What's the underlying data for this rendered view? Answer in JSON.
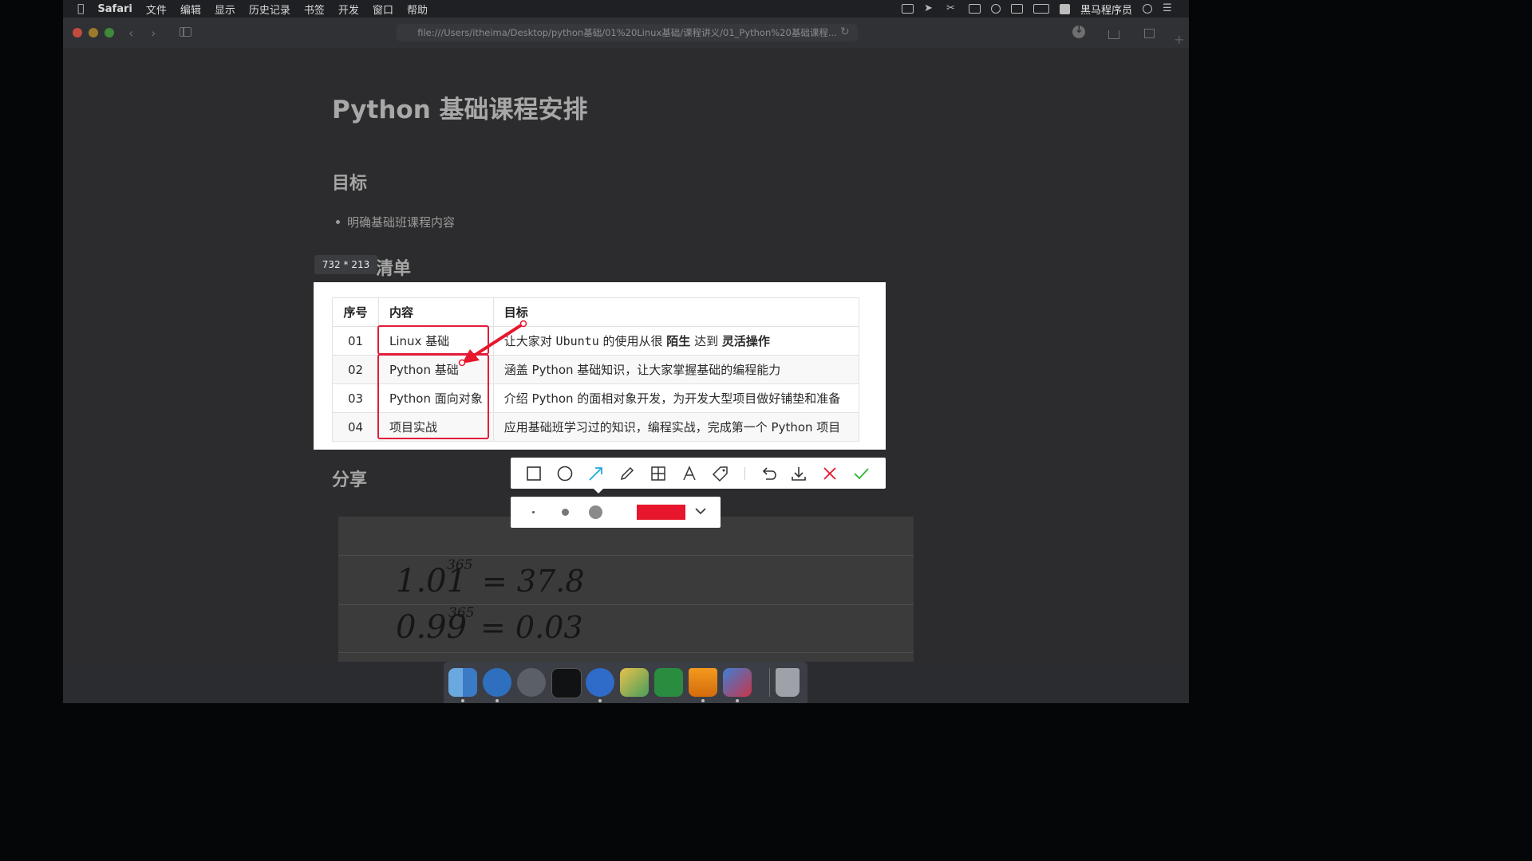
{
  "menubar": {
    "app": "Safari",
    "items": [
      "文件",
      "编辑",
      "显示",
      "历史记录",
      "书签",
      "开发",
      "窗口",
      "帮助"
    ],
    "user": "黑马程序员"
  },
  "browser": {
    "url": "file:///Users/itheima/Desktop/python基础/01%20Linux基础/课程讲义/01_Python%20基础课程..."
  },
  "page": {
    "title": "Python 基础课程安排",
    "goal_heading": "目标",
    "goal_item": "明确基础班课程内容",
    "list_heading_partial": "清单",
    "share_heading": "分享"
  },
  "capture": {
    "size_label": "732 * 213",
    "table": {
      "headers": [
        "序号",
        "内容",
        "目标"
      ],
      "rows": [
        {
          "seq": "01",
          "content": "Linux 基础",
          "goal_pre": "让大家对 ",
          "goal_mono": "Ubuntu",
          "goal_mid": " 的使用从很 ",
          "goal_b1": "陌生",
          "goal_mid2": " 达到 ",
          "goal_b2": "灵活操作"
        },
        {
          "seq": "02",
          "content": "Python 基础",
          "goal": "涵盖 Python 基础知识，让大家掌握基础的编程能力"
        },
        {
          "seq": "03",
          "content": "Python 面向对象",
          "goal": "介绍 Python 的面相对象开发，为开发大型项目做好铺垫和准备"
        },
        {
          "seq": "04",
          "content": "项目实战",
          "goal": "应用基础班学习过的知识，编程实战，完成第一个 Python 项目"
        }
      ]
    }
  },
  "handwriting": {
    "line1_base": "1.01",
    "line1_exp": "365",
    "line1_result": "= 37.8",
    "line2_base": "0.99",
    "line2_exp": "365",
    "line2_result": "= 0.03"
  },
  "annotation": {
    "tools": [
      "rectangle-icon",
      "ellipse-icon",
      "arrow-icon",
      "pencil-icon",
      "mosaic-icon",
      "text-icon",
      "tag-icon",
      "undo-icon",
      "download-icon",
      "close-icon",
      "confirm-icon"
    ],
    "active_tool": "arrow-icon",
    "color": "#e8162c",
    "accent": "#1fa9e0"
  },
  "colors": {
    "highlight_red": "#e21c3a",
    "confirm_green": "#2fb52f"
  }
}
